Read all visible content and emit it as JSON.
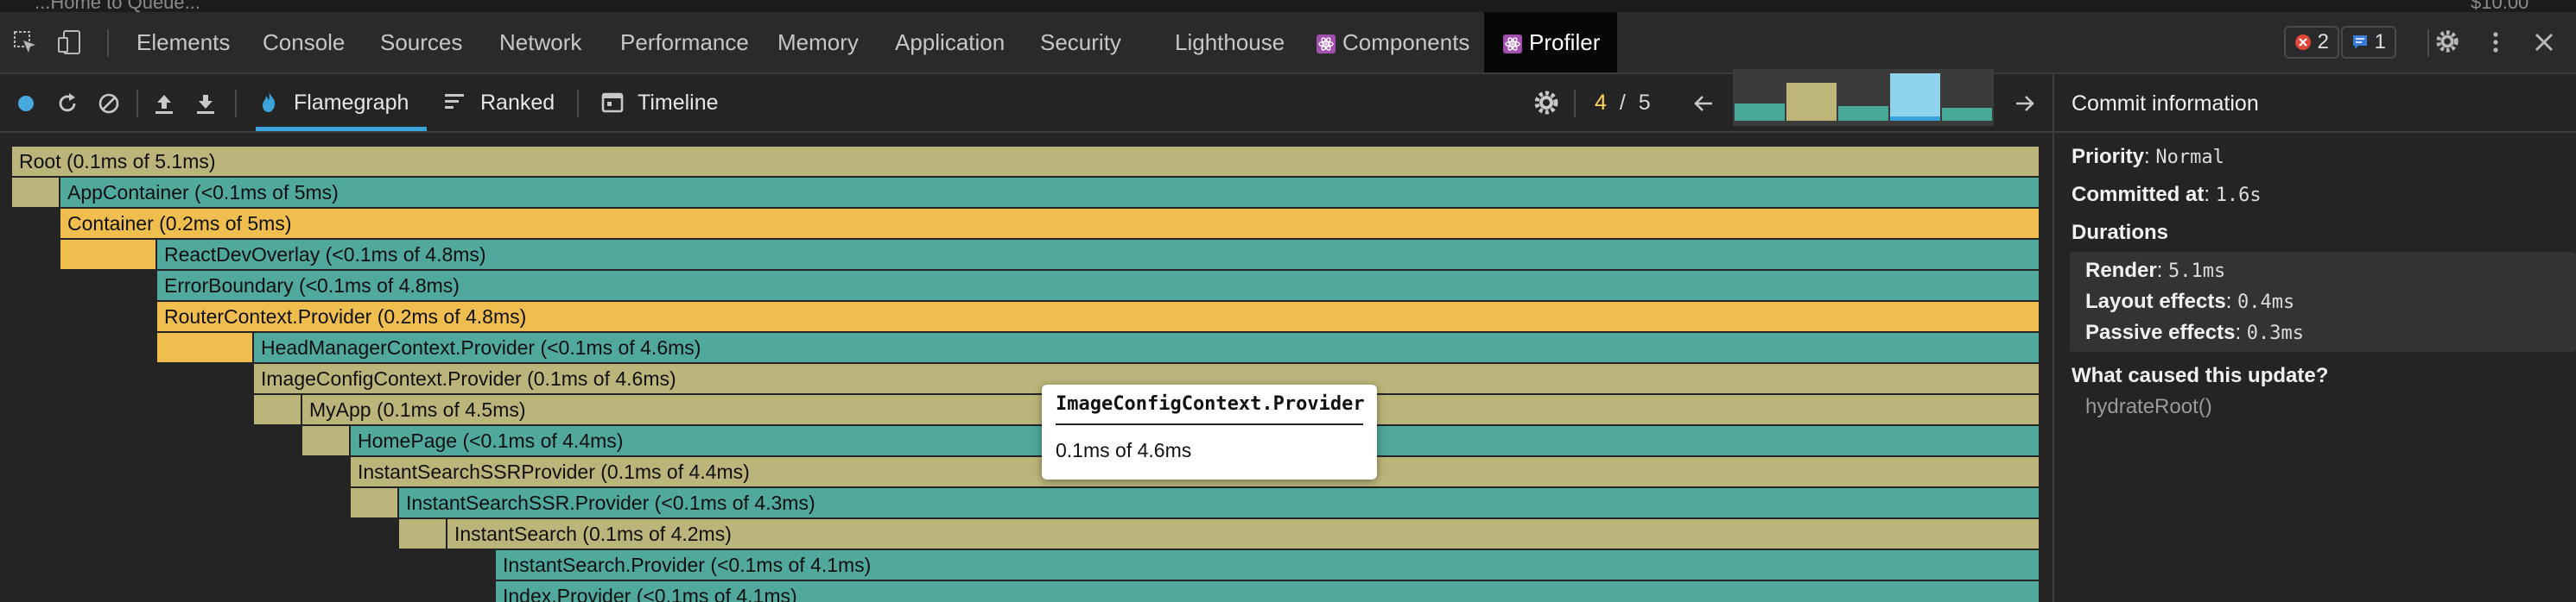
{
  "top_strip": {
    "text_left": "...Home to Queue...",
    "text_right": "$10.00"
  },
  "devtools": {
    "tabs": [
      {
        "label": "Elements"
      },
      {
        "label": "Console"
      },
      {
        "label": "Sources"
      },
      {
        "label": "Network"
      },
      {
        "label": "Performance"
      },
      {
        "label": "Memory"
      },
      {
        "label": "Application"
      },
      {
        "label": "Security"
      },
      {
        "label": "Lighthouse"
      },
      {
        "label": "Components"
      },
      {
        "label": "Profiler"
      }
    ],
    "active_tab": "Profiler",
    "errors_count": "2",
    "messages_count": "1"
  },
  "profiler": {
    "tabs": [
      {
        "label": "Flamegraph"
      },
      {
        "label": "Ranked"
      },
      {
        "label": "Timeline"
      }
    ],
    "active_tab": "Flamegraph",
    "commit_current": "4",
    "commit_separator": "/",
    "commit_total": "5",
    "commit_levels": [
      0.35,
      0.75,
      0.3,
      0.95,
      0.25
    ],
    "selected_commit_index": 3,
    "accent_color": "#3aa3dc"
  },
  "flamegraph": {
    "rows": [
      {
        "label": "Root (0.1ms of 5.1ms)",
        "color": "yellow"
      },
      {
        "label": "AppContainer (<0.1ms of 5ms)",
        "color": "teal"
      },
      {
        "label": "Container (0.2ms of 5ms)",
        "color": "orange"
      },
      {
        "label": "ReactDevOverlay (<0.1ms of 4.8ms)",
        "color": "teal"
      },
      {
        "label": "ErrorBoundary (<0.1ms of 4.8ms)",
        "color": "teal"
      },
      {
        "label": "RouterContext.Provider (0.2ms of 4.8ms)",
        "color": "orange"
      },
      {
        "label": "HeadManagerContext.Provider (<0.1ms of 4.6ms)",
        "color": "teal"
      },
      {
        "label": "ImageConfigContext.Provider (0.1ms of 4.6ms)",
        "color": "yellow"
      },
      {
        "label": "MyApp (0.1ms of 4.5ms)",
        "color": "yellow"
      },
      {
        "label": "HomePage (<0.1ms of 4.4ms)",
        "color": "teal"
      },
      {
        "label": "InstantSearchSSRProvider (0.1ms of 4.4ms)",
        "color": "yellow"
      },
      {
        "label": "InstantSearchSSR.Provider (<0.1ms of 4.3ms)",
        "color": "teal"
      },
      {
        "label": "InstantSearch (0.1ms of 4.2ms)",
        "color": "yellow"
      },
      {
        "label": "InstantSearch.Provider (<0.1ms of 4.1ms)",
        "color": "teal"
      },
      {
        "label": "Index.Provider (<0.1ms of 4.1ms)",
        "color": "teal"
      }
    ],
    "colors": {
      "yellow": "#bcb57b",
      "teal": "#51a89c",
      "orange": "#f0be4f"
    },
    "tooltip": {
      "title": "ImageConfigContext.Provider",
      "value": "0.1ms of 4.6ms"
    }
  },
  "commit_info": {
    "header": "Commit information",
    "priority_label": "Priority",
    "priority_value": "Normal",
    "committed_at_label": "Committed at",
    "committed_at_value": "1.6s",
    "durations_label": "Durations",
    "render_label": "Render",
    "render_value": "5.1ms",
    "layout_effects_label": "Layout effects",
    "layout_effects_value": "0.4ms",
    "passive_effects_label": "Passive effects",
    "passive_effects_value": "0.3ms",
    "cause_label": "What caused this update?",
    "cause_value": "hydrateRoot()"
  }
}
